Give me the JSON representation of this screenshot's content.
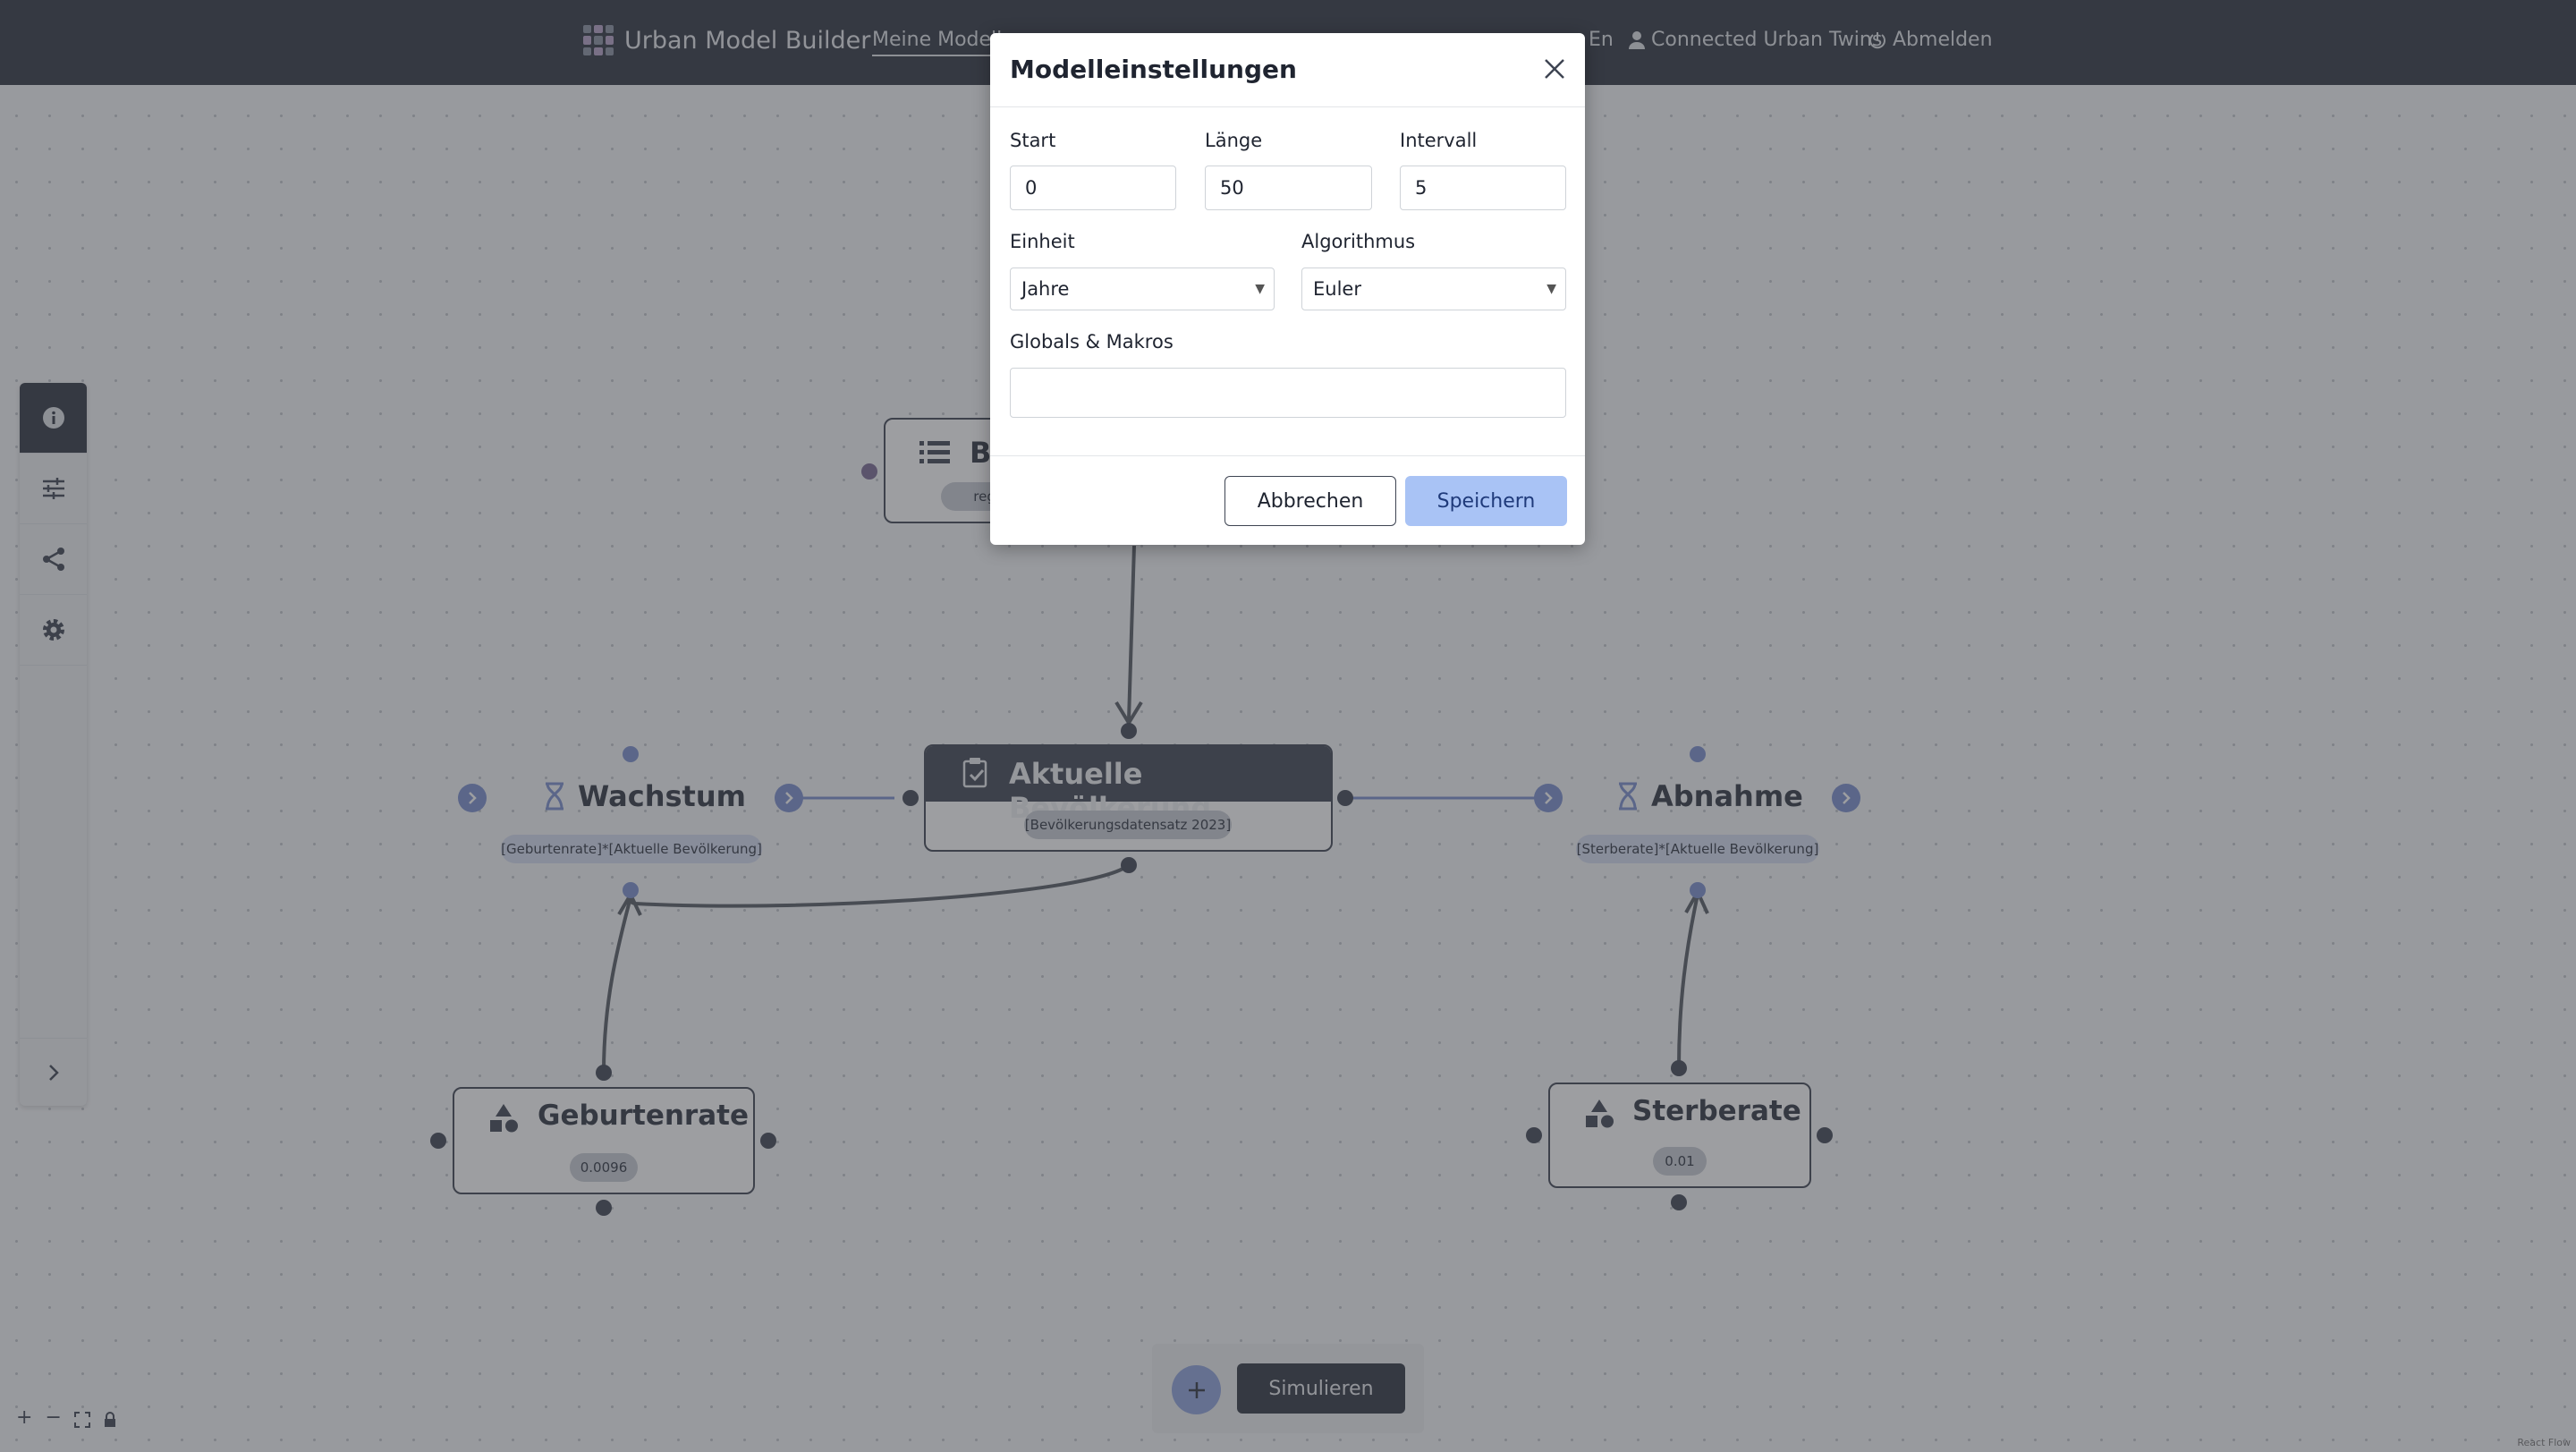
{
  "header": {
    "app_title": "Urban Model Builder",
    "nav_active": "Meine Modelle",
    "language": "En",
    "user": "Connected Urban Twins",
    "logout": "Abmelden"
  },
  "canvas": {
    "partial_node_title": "Be",
    "partial_node_formula": "region",
    "center_node": {
      "title": "Aktuelle Bevölkerung",
      "formula": "[Bevölkerungsdatensatz 2023]"
    },
    "flow_left": {
      "title": "Wachstum",
      "formula": "[Geburtenrate]*[Aktuelle Bevölkerung]"
    },
    "flow_right": {
      "title": "Abnahme",
      "formula": "[Sterberate]*[Aktuelle Bevölkerung]"
    },
    "var_left": {
      "title": "Geburtenrate",
      "value": "0.0096"
    },
    "var_right": {
      "title": "Sterberate",
      "value": "0.01"
    }
  },
  "modal": {
    "title": "Modelleinstellungen",
    "start_label": "Start",
    "start_value": "0",
    "length_label": "Länge",
    "length_value": "50",
    "interval_label": "Intervall",
    "interval_value": "5",
    "unit_label": "Einheit",
    "unit_value": "Jahre",
    "algorithm_label": "Algorithmus",
    "algorithm_value": "Euler",
    "globals_label": "Globals & Makros",
    "globals_value": "",
    "cancel_label": "Abbrechen",
    "save_label": "Speichern"
  },
  "toolbar": {
    "simulate_label": "Simulieren"
  },
  "attribution": "React Flow",
  "colors": {
    "header_bg": "#2e3441",
    "accent_blue": "#7a8fcf",
    "save_button": "#a9c3f5"
  }
}
